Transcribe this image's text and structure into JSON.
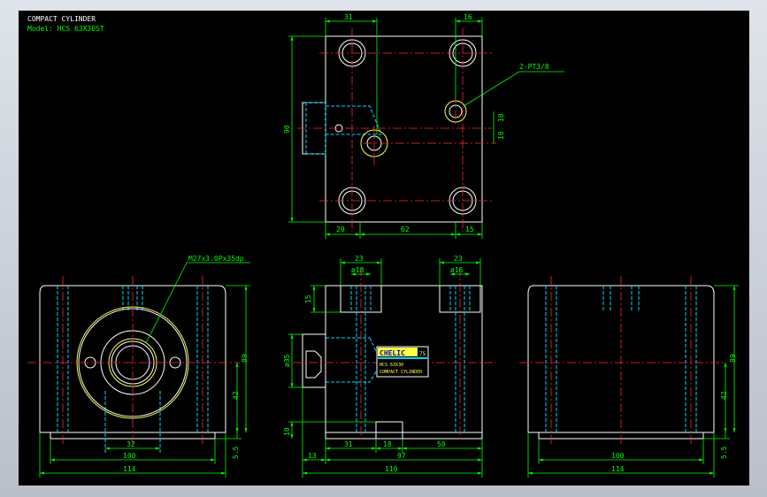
{
  "header": {
    "title": "COMPACT CYLINDER",
    "model": "Model: HCS 63X30ST"
  },
  "callouts": {
    "port": "2-PT3/8",
    "thread": "M27x3.0Px35dp"
  },
  "top_view": {
    "dims": {
      "top_left": "31",
      "top_right": "16",
      "height": "90",
      "r10a": "10",
      "r10b": "10",
      "b20": "20",
      "b62": "62",
      "b15": "15"
    }
  },
  "left_view": {
    "dims": {
      "h89": "89",
      "h42": "42",
      "h5": "5.5",
      "w32": "32",
      "w100": "100",
      "w114": "114"
    }
  },
  "side_view": {
    "dims": {
      "t23a": "23",
      "t23b": "23",
      "d18": "ø18",
      "d16": "ø16",
      "l15": "15",
      "d35": "ø35",
      "l10": "10",
      "b31": "31",
      "b18": "18",
      "b50": "50",
      "b13": "13",
      "b97": "97",
      "b110": "110"
    },
    "plate": {
      "brand": "CHELIC",
      "num": "75",
      "line1": "HCS 63X30",
      "line2": "COMPACT CYLINDER"
    }
  },
  "right_view": {
    "dims": {
      "h89": "89",
      "h42": "42",
      "h5": "5.5",
      "w100": "100",
      "w114": "114"
    }
  },
  "colors": {
    "background": "#000000",
    "outline": "#ffffff",
    "center": "#ff2a2a",
    "dimension": "#00ff00",
    "hidden": "#00d8ff",
    "thread": "#ffff40",
    "frame": "#c9ced6"
  }
}
